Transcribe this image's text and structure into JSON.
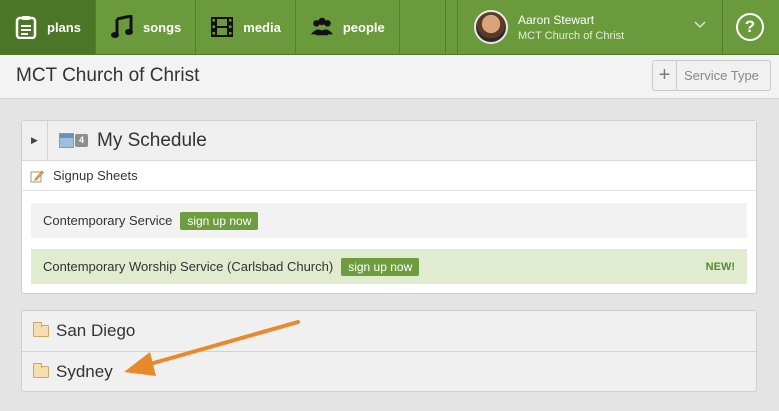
{
  "nav": {
    "tabs": [
      {
        "label": "plans",
        "icon": "clipboard-icon"
      },
      {
        "label": "songs",
        "icon": "music-note-icon"
      },
      {
        "label": "media",
        "icon": "film-icon"
      },
      {
        "label": "people",
        "icon": "people-icon"
      }
    ],
    "user": {
      "name": "Aaron Stewart",
      "org": "MCT Church of Christ"
    },
    "help_label": "?"
  },
  "header": {
    "title": "MCT Church of Christ",
    "service_type_button": "Service Type",
    "plus": "+"
  },
  "schedule": {
    "title": "My Schedule",
    "count": "4",
    "signup_title": "Signup Sheets",
    "services": [
      {
        "name": "Contemporary Service",
        "button": "sign up now",
        "badge": ""
      },
      {
        "name": "Contemporary Worship Service (Carlsbad Church)",
        "button": "sign up now",
        "badge": "NEW!"
      }
    ]
  },
  "folders": [
    {
      "name": "San Diego"
    },
    {
      "name": "Sydney"
    }
  ],
  "colors": {
    "nav_green": "#6a9a3c",
    "button_green": "#6e9c3e",
    "arrow_orange": "#e8892b"
  }
}
